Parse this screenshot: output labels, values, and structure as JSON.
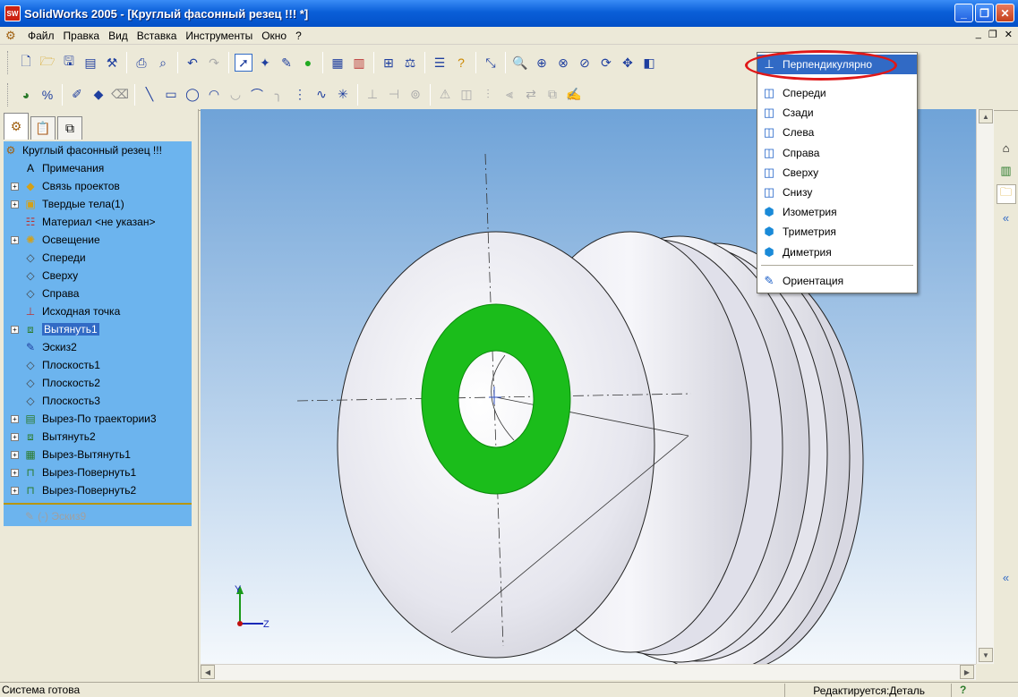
{
  "window": {
    "title": "SolidWorks 2005 - [Круглый фасонный резец !!! *]",
    "app_icon_text": "SW",
    "buttons": {
      "minimize": "_",
      "restore": "❐",
      "close": "✕"
    }
  },
  "menubar": {
    "items": [
      "Файл",
      "Правка",
      "Вид",
      "Вставка",
      "Инструменты",
      "Окно",
      "?"
    ],
    "mdi": {
      "minimize": "_",
      "restore": "❐",
      "close": "✕"
    }
  },
  "left_panel": {
    "tree": [
      {
        "label": "Круглый фасонный резец !!!",
        "icon": "part-icon",
        "expander": false,
        "indent": 0
      },
      {
        "label": "Примечания",
        "icon": "annotations-icon",
        "expander": false,
        "indent": 1
      },
      {
        "label": "Связь проектов",
        "icon": "design-binder-icon",
        "expander": true,
        "indent": 1
      },
      {
        "label": "Твердые тела(1)",
        "icon": "solid-bodies-icon",
        "expander": true,
        "indent": 1
      },
      {
        "label": "Материал <не указан>",
        "icon": "material-icon",
        "expander": false,
        "indent": 1
      },
      {
        "label": "Освещение",
        "icon": "lighting-icon",
        "expander": true,
        "indent": 1
      },
      {
        "label": "Спереди",
        "icon": "plane-icon",
        "expander": false,
        "indent": 1
      },
      {
        "label": "Сверху",
        "icon": "plane-icon",
        "expander": false,
        "indent": 1
      },
      {
        "label": "Справа",
        "icon": "plane-icon",
        "expander": false,
        "indent": 1
      },
      {
        "label": "Исходная точка",
        "icon": "origin-icon",
        "expander": false,
        "indent": 1
      },
      {
        "label": "Вытянуть1",
        "icon": "extrude-icon",
        "expander": true,
        "indent": 1,
        "selected": true
      },
      {
        "label": "Эскиз2",
        "icon": "sketch-icon",
        "expander": false,
        "indent": 1
      },
      {
        "label": "Плоскость1",
        "icon": "plane-icon",
        "expander": false,
        "indent": 1
      },
      {
        "label": "Плоскость2",
        "icon": "plane-icon",
        "expander": false,
        "indent": 1
      },
      {
        "label": "Плоскость3",
        "icon": "plane-icon",
        "expander": false,
        "indent": 1
      },
      {
        "label": "Вырез-По траектории3",
        "icon": "sweep-cut-icon",
        "expander": true,
        "indent": 1
      },
      {
        "label": "Вытянуть2",
        "icon": "extrude-icon",
        "expander": true,
        "indent": 1
      },
      {
        "label": "Вырез-Вытянуть1",
        "icon": "extrude-cut-icon",
        "expander": true,
        "indent": 1
      },
      {
        "label": "Вырез-Повернуть1",
        "icon": "revolve-cut-icon",
        "expander": true,
        "indent": 1
      },
      {
        "label": "Вырез-Повернуть2",
        "icon": "revolve-cut-icon",
        "expander": true,
        "indent": 1
      }
    ],
    "rollback_item": "(-) Эскиз9"
  },
  "view_menu": {
    "highlighted": "Перпендикулярно",
    "items": [
      "Спереди",
      "Сзади",
      "Слева",
      "Справа",
      "Сверху",
      "Снизу",
      "Изометрия",
      "Триметрия",
      "Диметрия"
    ],
    "footer": "Ориентация"
  },
  "triad": {
    "y": "Y",
    "z": "Z"
  },
  "status": {
    "left": "Система готова",
    "right": "Редактируется:Деталь",
    "help": "?"
  },
  "colors": {
    "title_blue": "#0a5fd8",
    "tree_bg": "#6cb4ee",
    "selection": "#316ac5",
    "face_highlight": "#1bbd1b",
    "callout_red": "#e01818"
  }
}
